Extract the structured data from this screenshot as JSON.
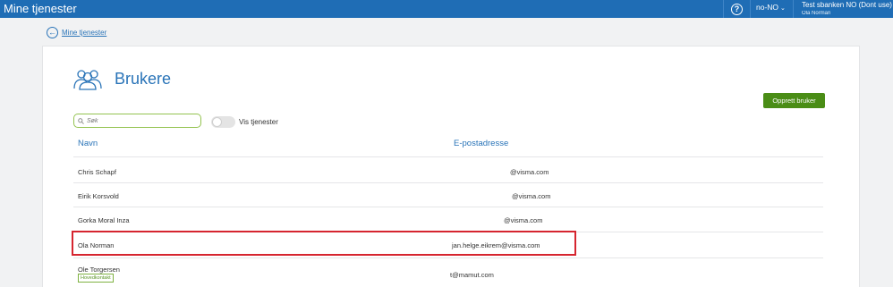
{
  "topbar": {
    "app_title": "Mine tjenester",
    "help_icon": "?",
    "language": "no-NO",
    "company": "Test sbanken NO (Dont use)",
    "user": "Ola Norman"
  },
  "back_link": {
    "label": "Mine tjenester"
  },
  "page": {
    "title": "Brukere",
    "search_placeholder": "Søk",
    "toggle_label": "Vis tjenester",
    "create_button": "Opprett bruker"
  },
  "table": {
    "columns": [
      "Navn",
      "E-postadresse"
    ],
    "rows": [
      {
        "name": "Chris Schapf",
        "email": "@visma.com"
      },
      {
        "name": "Eirik Korsvold",
        "email": "@visma.com"
      },
      {
        "name": "Gorka Moral Inza",
        "email": "@visma.com"
      },
      {
        "name": "Ola Norman",
        "email": "jan.helge.eikrem@visma.com"
      },
      {
        "name": "Ole Torgersen",
        "email": "t@mamut.com",
        "badge": "Hovedkontakt"
      }
    ]
  },
  "colors": {
    "topbar": "#1f6db5",
    "accent": "#2a74b8",
    "primary_button": "#4a8d16",
    "highlight": "#d6252f"
  },
  "icons": {
    "help": "help-icon",
    "back": "arrow-left-circle-icon",
    "users": "users-icon",
    "search": "search-icon"
  }
}
